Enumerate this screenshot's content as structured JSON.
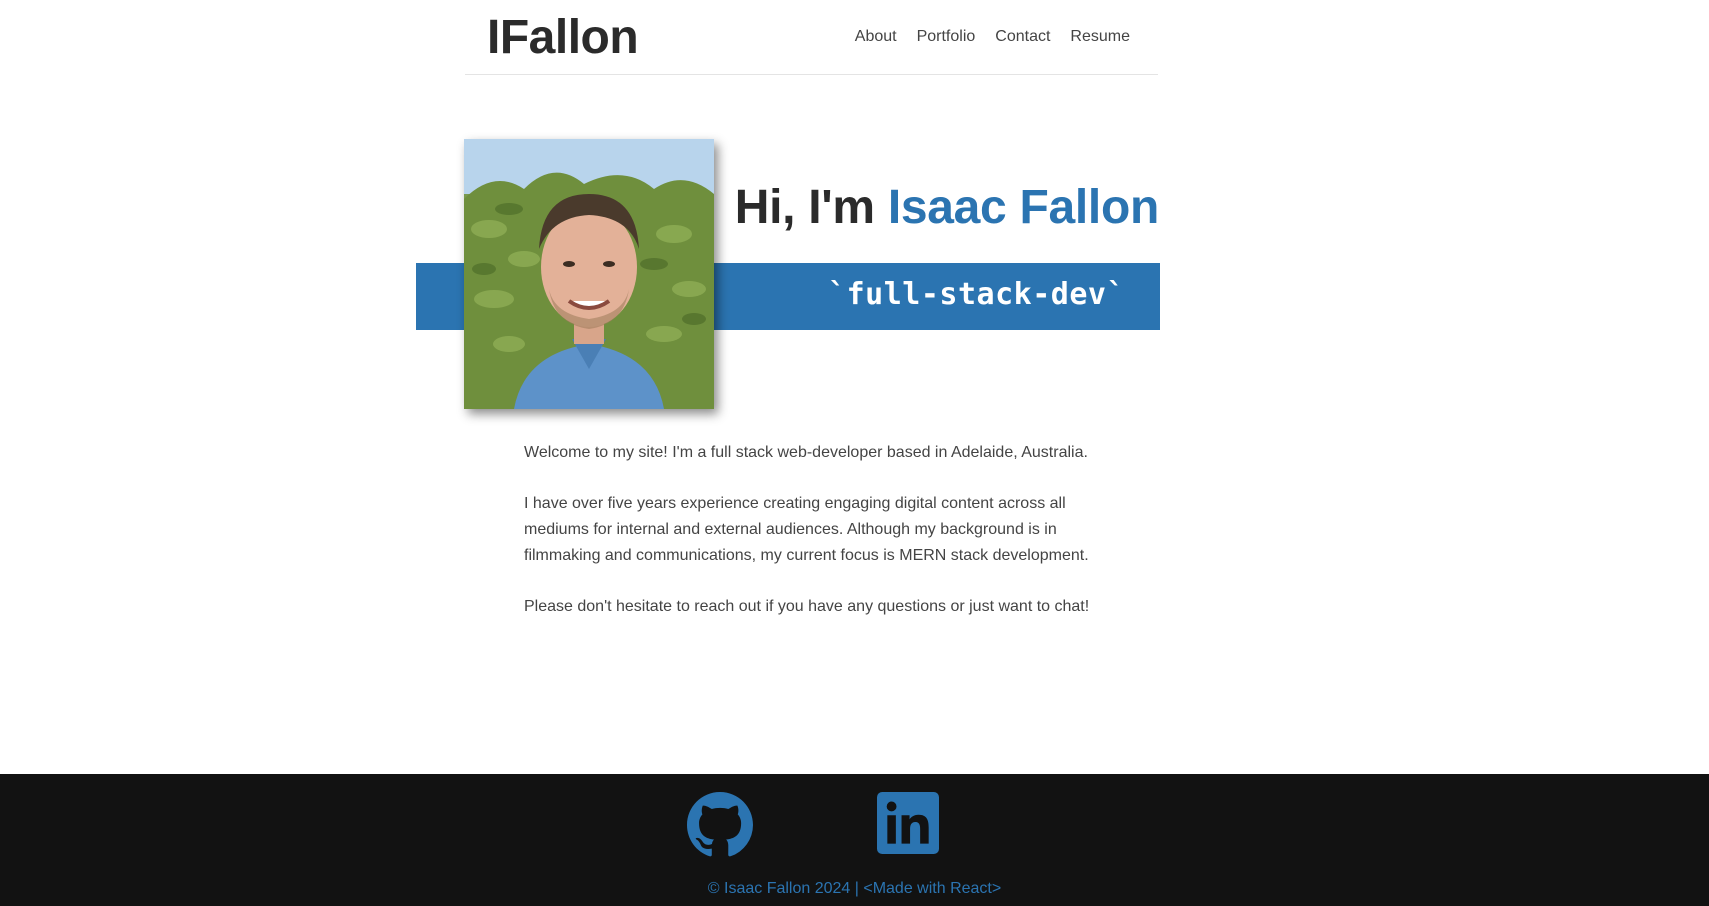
{
  "header": {
    "logo": "IFallon",
    "nav": [
      {
        "label": "About"
      },
      {
        "label": "Portfolio"
      },
      {
        "label": "Contact"
      },
      {
        "label": "Resume"
      }
    ]
  },
  "hero": {
    "greeting": "Hi, I'm ",
    "name": "Isaac Fallon",
    "tagline": "`full-stack-dev`",
    "photo_icon": "portrait-photo"
  },
  "intro": {
    "paragraphs": [
      "Welcome to my site! I'm a full stack web-developer based in Adelaide, Australia.",
      "I have over five years experience creating engaging digital content across all mediums for internal and external audiences. Although my background is in filmmaking and communications, my current focus is MERN stack development.",
      "Please don't hesitate to reach out if you have any questions or just want to chat!"
    ]
  },
  "footer": {
    "social": [
      {
        "icon": "github-icon"
      },
      {
        "icon": "linkedin-icon"
      }
    ],
    "copyright": "© Isaac Fallon 2024 | ",
    "made_with": "<Made with React>"
  },
  "colors": {
    "accent": "#2b74b1",
    "text": "#333333",
    "footer_bg": "#121212"
  }
}
